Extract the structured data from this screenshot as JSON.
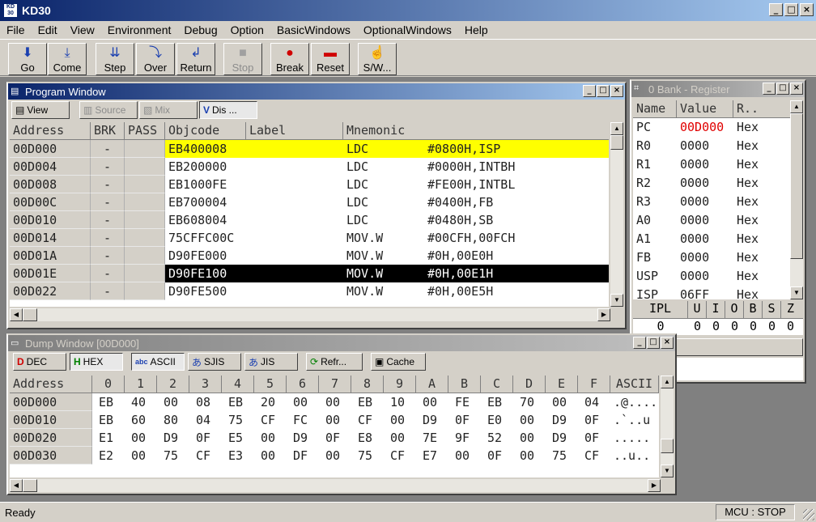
{
  "app": {
    "title": "KD30",
    "logo": "KD 30"
  },
  "menu": [
    "File",
    "Edit",
    "View",
    "Environment",
    "Debug",
    "Option",
    "BasicWindows",
    "OptionalWindows",
    "Help"
  ],
  "toolbar": [
    {
      "label": "Go",
      "icon": "down-arrow-icon"
    },
    {
      "label": "Come",
      "icon": "down-arrow-bar-icon"
    },
    {
      "label": "Step",
      "icon": "step-icon"
    },
    {
      "label": "Over",
      "icon": "step-over-icon"
    },
    {
      "label": "Return",
      "icon": "return-icon"
    },
    {
      "label": "Stop",
      "icon": "stop-icon",
      "disabled": true
    },
    {
      "label": "Break",
      "icon": "break-icon"
    },
    {
      "label": "Reset",
      "icon": "reset-icon"
    },
    {
      "label": "S/W...",
      "icon": "hand-icon"
    }
  ],
  "program": {
    "title": "Program Window",
    "buttons": {
      "view": "View",
      "source": "Source",
      "mix": "Mix",
      "dis": "Dis ..."
    },
    "headers": [
      "Address",
      "BRK",
      "PASS",
      "Objcode",
      "Label",
      "Mnemonic"
    ],
    "rows": [
      {
        "addr": "00D000",
        "brk": "-",
        "pass": "",
        "obj": "EB400008",
        "label": "",
        "mnem": "LDC",
        "oper": "#0800H,ISP",
        "hl": "yellow"
      },
      {
        "addr": "00D004",
        "brk": "-",
        "pass": "",
        "obj": "EB200000",
        "label": "",
        "mnem": "LDC",
        "oper": "#0000H,INTBH",
        "hl": ""
      },
      {
        "addr": "00D008",
        "brk": "-",
        "pass": "",
        "obj": "EB1000FE",
        "label": "",
        "mnem": "LDC",
        "oper": "#FE00H,INTBL",
        "hl": ""
      },
      {
        "addr": "00D00C",
        "brk": "-",
        "pass": "",
        "obj": "EB700004",
        "label": "",
        "mnem": "LDC",
        "oper": "#0400H,FB",
        "hl": ""
      },
      {
        "addr": "00D010",
        "brk": "-",
        "pass": "",
        "obj": "EB608004",
        "label": "",
        "mnem": "LDC",
        "oper": "#0480H,SB",
        "hl": ""
      },
      {
        "addr": "00D014",
        "brk": "-",
        "pass": "",
        "obj": "75CFFC00C",
        "label": "",
        "mnem": "MOV.W",
        "oper": "#00CFH,00FCH",
        "hl": ""
      },
      {
        "addr": "00D01A",
        "brk": "-",
        "pass": "",
        "obj": "D90FE000",
        "label": "",
        "mnem": "MOV.W",
        "oper": "#0H,00E0H",
        "hl": ""
      },
      {
        "addr": "00D01E",
        "brk": "-",
        "pass": "",
        "obj": "D90FE100",
        "label": "",
        "mnem": "MOV.W",
        "oper": "#0H,00E1H",
        "hl": "black"
      },
      {
        "addr": "00D022",
        "brk": "-",
        "pass": "",
        "obj": "D90FE500",
        "label": "",
        "mnem": "MOV.W",
        "oper": "#0H,00E5H",
        "hl": ""
      }
    ]
  },
  "register": {
    "title": "0 Bank - Register",
    "headers": [
      "Name",
      "Value",
      "R.."
    ],
    "rows": [
      {
        "name": "PC",
        "value": "00D000",
        "radix": "Hex",
        "changed": true
      },
      {
        "name": "R0",
        "value": "0000",
        "radix": "Hex"
      },
      {
        "name": "R1",
        "value": "0000",
        "radix": "Hex"
      },
      {
        "name": "R2",
        "value": "0000",
        "radix": "Hex"
      },
      {
        "name": "R3",
        "value": "0000",
        "radix": "Hex"
      },
      {
        "name": "A0",
        "value": "0000",
        "radix": "Hex"
      },
      {
        "name": "A1",
        "value": "0000",
        "radix": "Hex"
      },
      {
        "name": "FB",
        "value": "0000",
        "radix": "Hex"
      },
      {
        "name": "USP",
        "value": "0000",
        "radix": "Hex"
      },
      {
        "name": "ISP",
        "value": "06FF",
        "radix": "Hex"
      }
    ],
    "flag_headers": [
      "IPL",
      "U",
      "I",
      "O",
      "B",
      "S",
      "Z"
    ],
    "flag_values": [
      "0",
      "0",
      "0",
      "0",
      "0",
      "0",
      "0"
    ]
  },
  "dump": {
    "title": "Dump Window [00D000]",
    "buttons": {
      "dec": "DEC",
      "hex": "HEX",
      "ascii": "ASCII",
      "sjis": "SJIS",
      "jis": "JIS",
      "refresh": "Refr...",
      "cache": "Cache"
    },
    "headers": [
      "Address",
      "0",
      "1",
      "2",
      "3",
      "4",
      "5",
      "6",
      "7",
      "8",
      "9",
      "A",
      "B",
      "C",
      "D",
      "E",
      "F",
      "ASCII"
    ],
    "rows": [
      {
        "addr": "00D000",
        "bytes": [
          "EB",
          "40",
          "00",
          "08",
          "EB",
          "20",
          "00",
          "00",
          "EB",
          "10",
          "00",
          "FE",
          "EB",
          "70",
          "00",
          "04"
        ],
        "ascii": ".@...."
      },
      {
        "addr": "00D010",
        "bytes": [
          "EB",
          "60",
          "80",
          "04",
          "75",
          "CF",
          "FC",
          "00",
          "CF",
          "00",
          "D9",
          "0F",
          "E0",
          "00",
          "D9",
          "0F"
        ],
        "ascii": ".`..u"
      },
      {
        "addr": "00D020",
        "bytes": [
          "E1",
          "00",
          "D9",
          "0F",
          "E5",
          "00",
          "D9",
          "0F",
          "E8",
          "00",
          "7E",
          "9F",
          "52",
          "00",
          "D9",
          "0F"
        ],
        "ascii": "....."
      },
      {
        "addr": "00D030",
        "bytes": [
          "E2",
          "00",
          "75",
          "CF",
          "E3",
          "00",
          "DF",
          "00",
          "75",
          "CF",
          "E7",
          "00",
          "0F",
          "00",
          "75",
          "CF"
        ],
        "ascii": "..u.."
      }
    ]
  },
  "status": {
    "text": "Ready",
    "mcu": "MCU : STOP"
  }
}
